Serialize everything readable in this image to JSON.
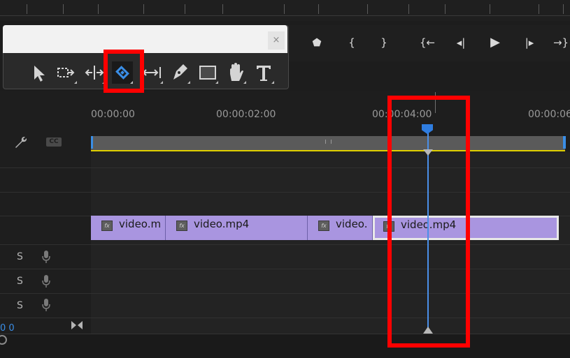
{
  "timeline": {
    "time_labels": [
      "00:00:00",
      "00:00:02:00",
      "00:00:04:00",
      "00:00:06:"
    ],
    "cc_label": "CC",
    "timecode_fragment": "0 0",
    "audio_solo_labels": [
      "S",
      "S",
      "S"
    ],
    "clips": [
      {
        "name": "video.m",
        "fx": "fx"
      },
      {
        "name": "video.mp4",
        "fx": "fx"
      },
      {
        "name": "video.",
        "fx": "fx"
      },
      {
        "name": "video.mp4",
        "fx": "fx"
      }
    ]
  },
  "tools": [
    {
      "name": "selection-tool",
      "icon": "arrow-icon"
    },
    {
      "name": "track-select-tool",
      "icon": "track-select-icon"
    },
    {
      "name": "ripple-edit-tool",
      "icon": "ripple-icon"
    },
    {
      "name": "razor-tool",
      "icon": "razor-icon",
      "selected": true
    },
    {
      "name": "slip-tool",
      "icon": "slip-icon"
    },
    {
      "name": "pen-tool",
      "icon": "pen-icon"
    },
    {
      "name": "rectangle-tool",
      "icon": "rectangle-icon"
    },
    {
      "name": "hand-tool",
      "icon": "hand-icon"
    },
    {
      "name": "type-tool",
      "icon": "type-icon",
      "label": "T"
    }
  ],
  "tools_close": "×",
  "transport": {
    "buttons": [
      "⬟",
      "{",
      "}",
      "{←",
      "◂|",
      "▶",
      "|▸",
      "→}"
    ]
  },
  "colors": {
    "clip": "#a995e0",
    "playhead": "#2f7de0",
    "highlight": "#ff0000",
    "work_area": "#e0d000",
    "selected_tool": "#3a8ee6"
  }
}
